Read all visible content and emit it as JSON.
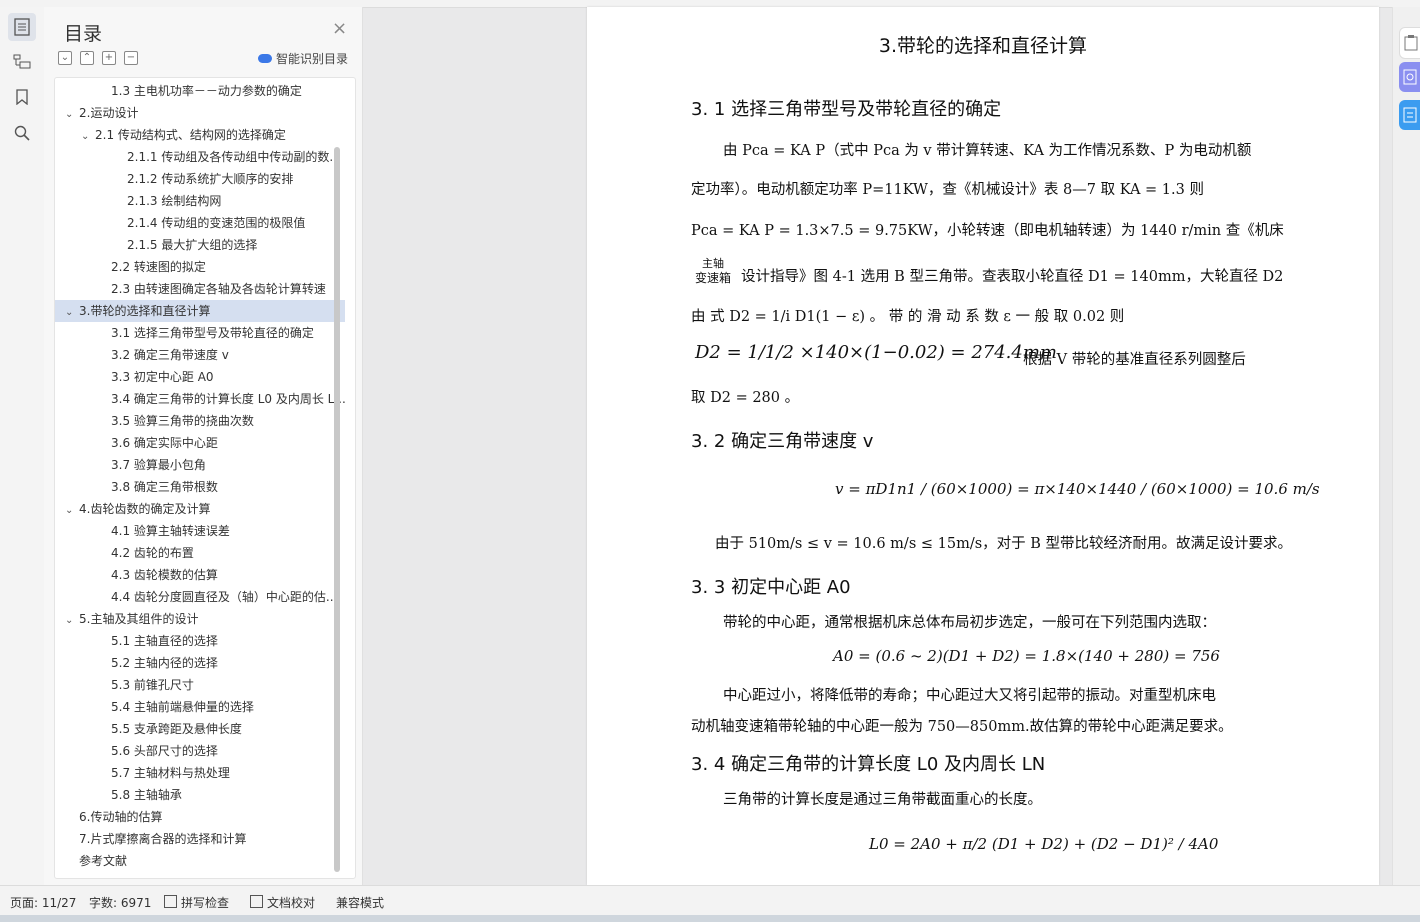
{
  "toc": {
    "title": "目录",
    "smart_label": "智能识别目录",
    "items": [
      {
        "text": "1.3 主电机功率－－动力参数的确定",
        "level": 2,
        "arrow": ""
      },
      {
        "text": "2.运动设计",
        "level": 0,
        "arrow": "⌄"
      },
      {
        "text": "2.1 传动结构式、结构网的选择确定",
        "level": 1,
        "arrow": "⌄"
      },
      {
        "text": "2.1.1 传动组及各传动组中传动副的数...",
        "level": 3,
        "arrow": ""
      },
      {
        "text": "2.1.2  传动系统扩大顺序的安排",
        "level": 3,
        "arrow": ""
      },
      {
        "text": "2.1.3  绘制结构网",
        "level": 3,
        "arrow": ""
      },
      {
        "text": "2.1.4  传动组的变速范围的极限值",
        "level": 3,
        "arrow": ""
      },
      {
        "text": "2.1.5 最大扩大组的选择",
        "level": 3,
        "arrow": ""
      },
      {
        "text": "2.2 转速图的拟定",
        "level": 2,
        "arrow": ""
      },
      {
        "text": "2.3  由转速图确定各轴及各齿轮计算转速",
        "level": 2,
        "arrow": ""
      },
      {
        "text": "3.带轮的选择和直径计算",
        "level": 0,
        "arrow": "⌄"
      },
      {
        "text": "3.1 选择三角带型号及带轮直径的确定",
        "level": 2,
        "arrow": ""
      },
      {
        "text": "3.2 确定三角带速度 v",
        "level": 2,
        "arrow": ""
      },
      {
        "text": "3.3 初定中心距 A0",
        "level": 2,
        "arrow": ""
      },
      {
        "text": "3.4 确定三角带的计算长度 L0 及内周长 L...",
        "level": 2,
        "arrow": ""
      },
      {
        "text": "3.5 验算三角带的挠曲次数",
        "level": 2,
        "arrow": ""
      },
      {
        "text": "3.6 确定实际中心距",
        "level": 2,
        "arrow": ""
      },
      {
        "text": "3.7 验算最小包角",
        "level": 2,
        "arrow": ""
      },
      {
        "text": "3.8 确定三角带根数",
        "level": 2,
        "arrow": ""
      },
      {
        "text": "4.齿轮齿数的确定及计算",
        "level": 0,
        "arrow": "⌄"
      },
      {
        "text": "4.1 验算主轴转速误差",
        "level": 2,
        "arrow": ""
      },
      {
        "text": "4.2 齿轮的布置",
        "level": 2,
        "arrow": ""
      },
      {
        "text": "4.3  齿轮模数的估算",
        "level": 2,
        "arrow": ""
      },
      {
        "text": "4.4  齿轮分度圆直径及（轴）中心距的估...",
        "level": 2,
        "arrow": ""
      },
      {
        "text": "5.主轴及其组件的设计",
        "level": 0,
        "arrow": "⌄"
      },
      {
        "text": "5.1 主轴直径的选择",
        "level": 2,
        "arrow": ""
      },
      {
        "text": "5.2 主轴内径的选择",
        "level": 2,
        "arrow": ""
      },
      {
        "text": "5.3 前锥孔尺寸",
        "level": 2,
        "arrow": ""
      },
      {
        "text": "5.4 主轴前端悬伸量的选择",
        "level": 2,
        "arrow": ""
      },
      {
        "text": "5.5 支承跨距及悬伸长度",
        "level": 2,
        "arrow": ""
      },
      {
        "text": "5.6 头部尺寸的选择",
        "level": 2,
        "arrow": ""
      },
      {
        "text": "5.7 主轴材料与热处理",
        "level": 2,
        "arrow": ""
      },
      {
        "text": "5.8 主轴轴承",
        "level": 2,
        "arrow": ""
      },
      {
        "text": "6.传动轴的估算",
        "level": 0,
        "arrow": ""
      },
      {
        "text": "7.片式摩擦离合器的选择和计算",
        "level": 0,
        "arrow": ""
      },
      {
        "text": "参考文献",
        "level": 0,
        "arrow": ""
      }
    ],
    "selected_index": 10
  },
  "doc": {
    "title": "3.带轮的选择和直径计算",
    "h_3_1": "3. 1 选择三角带型号及带轮直径的确定",
    "l1": "由 Pca = KA P（式中 Pca 为 v 带计算转速、KA 为工作情况系数、P 为电动机额",
    "l2": "定功率）。电动机额定功率 P=11KW，查《机械设计》表 8—7 取 KA = 1.3 则",
    "l3": "Pca = KA P = 1.3×7.5 = 9.75KW，小轮转速（即电机轴转速）为 1440 r/min 查《机床",
    "l4a": "主轴",
    "l4b": "变速箱",
    "l4c": "设计指导》图 4-1 选用 B 型三角带。查表取小轮直径 D1 = 140mm，大轮直径 D2",
    "l5": "由 式  D2 = 1/i D1(1 − ε)  。 带 的 滑 动 系 数  ε  一 般 取  0.02  则",
    "l6a": "D2 = 1/1/2 ×140×(1−0.02) = 274.4mm",
    "l6b": "根据 V 带轮的基准直径系列圆整后",
    "l7": "取 D2 = 280 。",
    "h_3_2": "3. 2 确定三角带速度 v",
    "eq_v": "v = πD1n1 / (60×1000) = π×140×1440 / (60×1000) = 10.6 m/s",
    "l8": "由于 510m/s ≤ v = 10.6 m/s ≤ 15m/s，对于 B 型带比较经济耐用。故满足设计要求。",
    "h_3_3": "3. 3 初定中心距 A0",
    "l9": "带轮的中心距，通常根据机床总体布局初步选定，一般可在下列范围内选取：",
    "eq_a": "A0 = (0.6 ~ 2)(D1 + D2) = 1.8×(140 + 280) = 756",
    "l10": "中心距过小，将降低带的寿命；中心距过大又将引起带的振动。对重型机床电",
    "l11": "动机轴变速箱带轮轴的中心距一般为 750—850mm.故估算的带轮中心距满足要求。",
    "h_3_4": "3. 4 确定三角带的计算长度 L0 及内周长 LN",
    "l12": "三角带的计算长度是通过三角带截面重心的长度。",
    "eq_l": "L0 = 2A0 + π/2 (D1 + D2) + (D2 − D1)² / 4A0"
  },
  "status": {
    "page": "页面: 11/27",
    "words": "字数: 6971",
    "spell": "拼写检查",
    "proof": "文档校对",
    "compat": "兼容模式"
  },
  "colors": {
    "accent": "#3b78e7",
    "selected": "#d5dff0"
  }
}
